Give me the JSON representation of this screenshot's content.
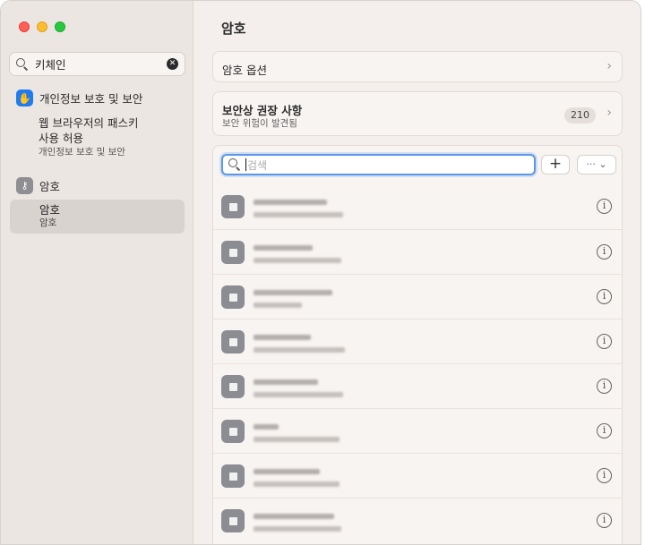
{
  "window": {
    "controls": [
      "close",
      "minimize",
      "maximize"
    ]
  },
  "sidebar": {
    "search": {
      "value": "키체인",
      "clear_icon": "x-circle-icon"
    },
    "sections": [
      {
        "icon": "hand-icon",
        "icon_color": "#1d7cf2",
        "label": "개인정보 보호 및 보안",
        "result": {
          "title": "웹 브라우저의 패스키\n사용 허용",
          "caption": "개인정보 보호 및 보안"
        }
      },
      {
        "icon": "key-icon",
        "icon_color": "#8e8e93",
        "label": "암호",
        "result": {
          "title": "암호",
          "caption": "암호",
          "selected": true
        }
      }
    ]
  },
  "main": {
    "title": "암호",
    "options_card": {
      "label": "암호 옵션"
    },
    "security_card": {
      "label": "보안상 권장 사항",
      "sub": "보안 위험이 발견됨",
      "count": "210"
    },
    "list": {
      "search_placeholder": "검색",
      "add_label": "+",
      "more_label": "··· ⌄",
      "rows": [
        {
          "l1": 82,
          "l2": 100
        },
        {
          "l1": 66,
          "l2": 98
        },
        {
          "l1": 88,
          "l2": 54
        },
        {
          "l1": 64,
          "l2": 102
        },
        {
          "l1": 72,
          "l2": 100
        },
        {
          "l1": 28,
          "l2": 96
        },
        {
          "l1": 74,
          "l2": 96
        },
        {
          "l1": 90,
          "l2": 98
        }
      ]
    }
  }
}
